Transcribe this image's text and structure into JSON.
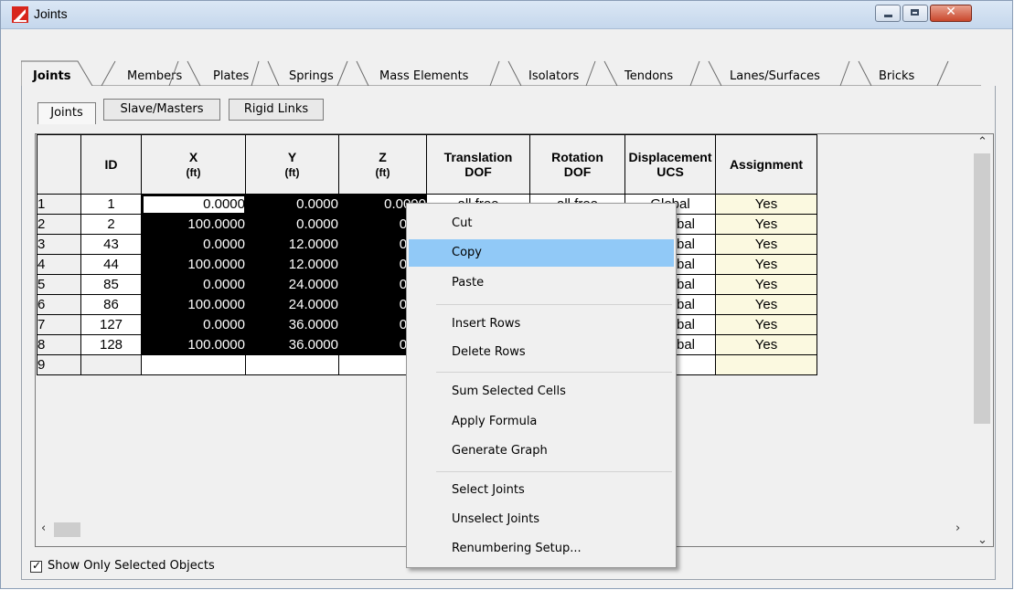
{
  "window": {
    "title": "Joints"
  },
  "tabs": [
    {
      "label": "Joints",
      "active": true
    },
    {
      "label": "Members"
    },
    {
      "label": "Plates"
    },
    {
      "label": "Springs"
    },
    {
      "label": "Mass Elements"
    },
    {
      "label": "Isolators"
    },
    {
      "label": "Tendons"
    },
    {
      "label": "Lanes/Surfaces"
    },
    {
      "label": "Bricks"
    }
  ],
  "subtabs": [
    {
      "label": "Joints",
      "active": true
    },
    {
      "label": "Slave/Masters"
    },
    {
      "label": "Rigid Links"
    }
  ],
  "grid": {
    "headers": {
      "id": "ID",
      "x": "X",
      "x_unit": "(ft)",
      "y": "Y",
      "y_unit": "(ft)",
      "z": "Z",
      "z_unit": "(ft)",
      "tdof": "Translation",
      "tdof2": "DOF",
      "rdof": "Rotation",
      "rdof2": "DOF",
      "disp": "Displacement",
      "disp2": "UCS",
      "assign": "Assignment"
    },
    "rows": [
      {
        "n": "1",
        "id": "1",
        "x": "0.0000",
        "y": "0.0000",
        "z": "0.0000",
        "t": "all free",
        "r": "all free",
        "ucs": "Global",
        "a": "Yes"
      },
      {
        "n": "2",
        "id": "2",
        "x": "100.0000",
        "y": "0.0000",
        "z": "0.00",
        "t": "",
        "r": "",
        "ucs": "lobal",
        "a": "Yes"
      },
      {
        "n": "3",
        "id": "43",
        "x": "0.0000",
        "y": "12.0000",
        "z": "0.00",
        "t": "",
        "r": "",
        "ucs": "lobal",
        "a": "Yes"
      },
      {
        "n": "4",
        "id": "44",
        "x": "100.0000",
        "y": "12.0000",
        "z": "0.00",
        "t": "",
        "r": "",
        "ucs": "lobal",
        "a": "Yes"
      },
      {
        "n": "5",
        "id": "85",
        "x": "0.0000",
        "y": "24.0000",
        "z": "0.00",
        "t": "",
        "r": "",
        "ucs": "lobal",
        "a": "Yes"
      },
      {
        "n": "6",
        "id": "86",
        "x": "100.0000",
        "y": "24.0000",
        "z": "0.00",
        "t": "",
        "r": "",
        "ucs": "lobal",
        "a": "Yes"
      },
      {
        "n": "7",
        "id": "127",
        "x": "0.0000",
        "y": "36.0000",
        "z": "0.00",
        "t": "",
        "r": "",
        "ucs": "lobal",
        "a": "Yes"
      },
      {
        "n": "8",
        "id": "128",
        "x": "100.0000",
        "y": "36.0000",
        "z": "0.00",
        "t": "",
        "r": "",
        "ucs": "lobal",
        "a": "Yes"
      },
      {
        "n": "9",
        "id": "",
        "x": "",
        "y": "",
        "z": "",
        "t": "",
        "r": "",
        "ucs": "",
        "a": ""
      }
    ]
  },
  "context_menu": {
    "items": [
      {
        "label": "Cut"
      },
      {
        "label": "Copy",
        "highlighted": true
      },
      {
        "label": "Paste"
      },
      {
        "label": "Insert Rows"
      },
      {
        "label": "Delete Rows"
      },
      {
        "label": "Sum Selected Cells"
      },
      {
        "label": "Apply Formula"
      },
      {
        "label": "Generate Graph"
      },
      {
        "label": "Select Joints"
      },
      {
        "label": "Unselect Joints"
      },
      {
        "label": "Renumbering Setup..."
      }
    ]
  },
  "footer": {
    "show_selected_label": "Show Only Selected Objects",
    "show_selected_checked": true
  },
  "colors": {
    "selection_bg": "#000000",
    "assignment_bg": "#fbf9e0",
    "menu_highlight": "#91c9f7",
    "app_icon_red": "#d8261c"
  }
}
